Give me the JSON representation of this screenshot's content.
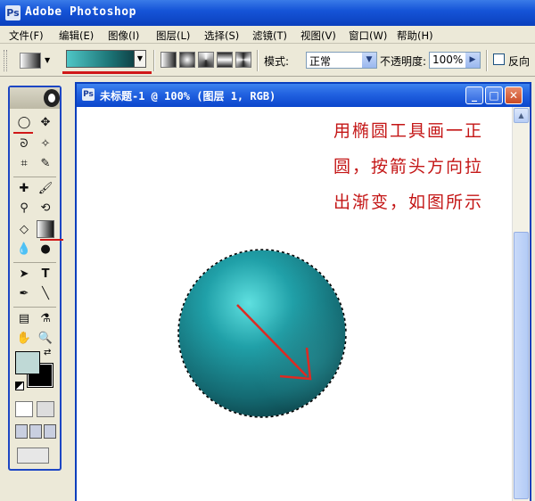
{
  "app": {
    "title": "Adobe Photoshop",
    "icon": "photoshop-icon"
  },
  "menu": [
    "文件(F)",
    "编辑(E)",
    "图像(I)",
    "图层(L)",
    "选择(S)",
    "滤镜(T)",
    "视图(V)",
    "窗口(W)",
    "帮助(H)"
  ],
  "options": {
    "mode_label": "模式:",
    "mode_value": "正常",
    "opacity_label": "不透明度:",
    "opacity_value": "100%",
    "reverse_label": "反向",
    "gradient_colors": [
      "#4fc6c6",
      "#1c7476",
      "#0a2b30"
    ]
  },
  "document": {
    "title": "未标题-1 @ 100% (图层 1, RGB)"
  },
  "instruction": {
    "line1": "用椭圆工具画一正",
    "line2": "圆，按箭头方向拉",
    "line3": "出渐变，如图所示"
  },
  "colors": {
    "highlight_red": "#d01818",
    "foreground": "#bfd9d6",
    "background": "#000000",
    "sphere_light": "#5fe0e0",
    "sphere_dark": "#0b3c42"
  }
}
